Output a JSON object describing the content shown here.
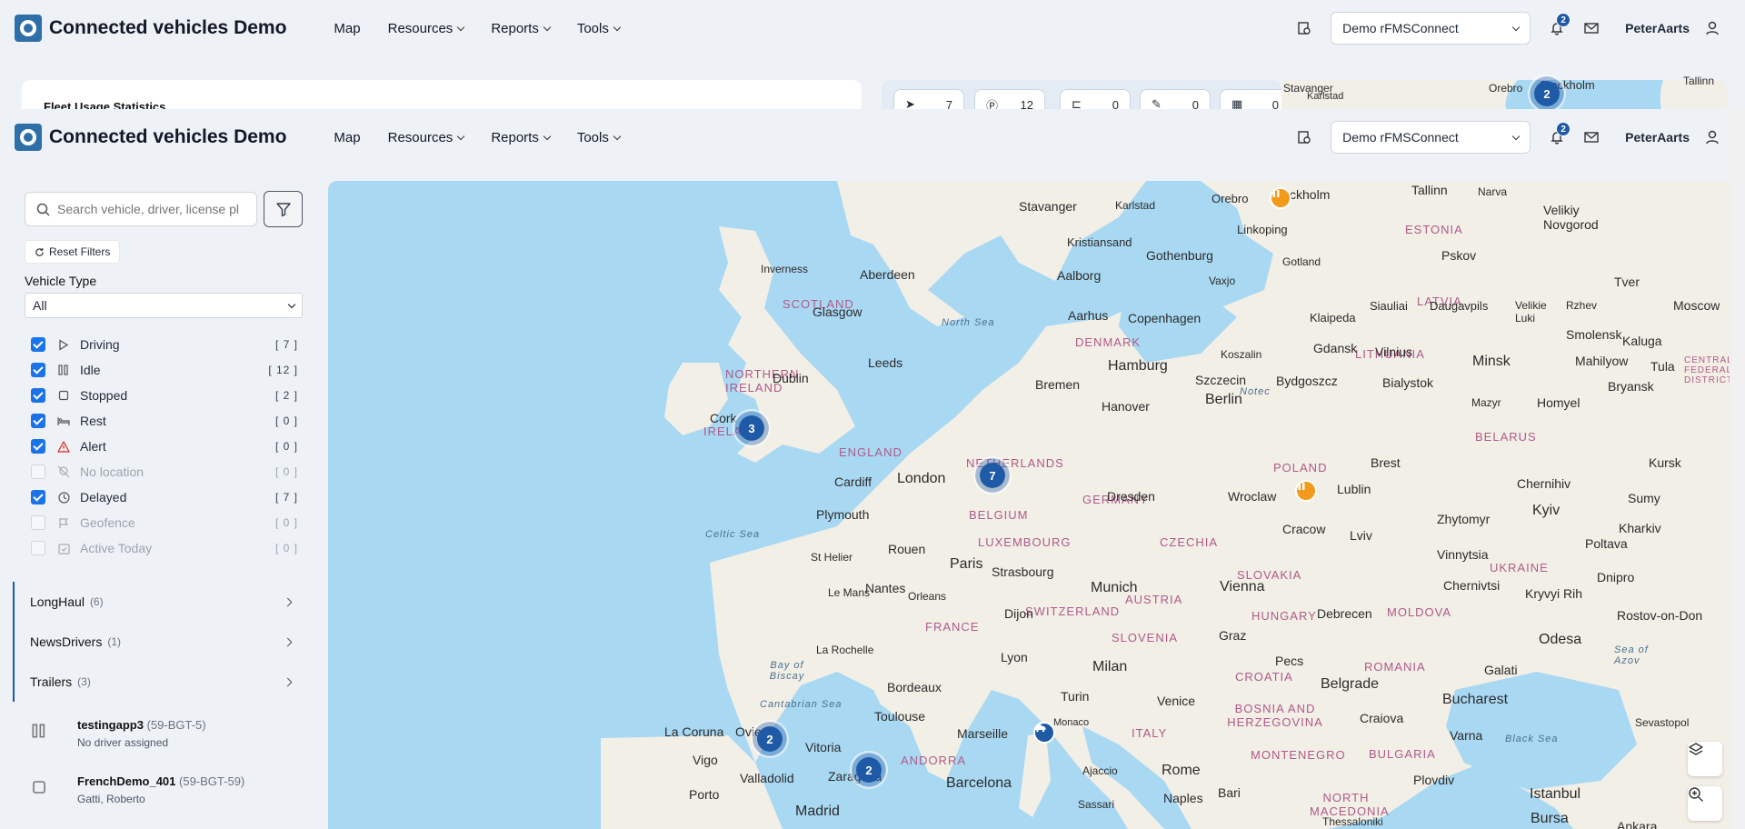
{
  "app": {
    "title": "Connected vehicles Demo",
    "nav": [
      "Map",
      "Resources",
      "Reports",
      "Tools"
    ],
    "account_select": "Demo rFMSConnect",
    "notifications_count": "2",
    "username": "PeterAarts"
  },
  "background": {
    "stats_title": "Fleet Usage Statistics",
    "pills": [
      "7",
      "12",
      "0",
      "0",
      "0"
    ],
    "map_labels": [
      "Stavanger",
      "Karlstad",
      "Orebro",
      "Stockholm",
      "Tallinn"
    ],
    "cluster": "2"
  },
  "sidebar": {
    "search_placeholder": "Search vehicle, driver, license plate",
    "reset_label": "Reset Filters",
    "vehicle_type_label": "Vehicle Type",
    "vehicle_type_value": "All",
    "statuses": [
      {
        "label": "Driving",
        "count": "[ 7 ]",
        "checked": true,
        "icon": "play-icon"
      },
      {
        "label": "Idle",
        "count": "[ 12 ]",
        "checked": true,
        "icon": "idle-icon"
      },
      {
        "label": "Stopped",
        "count": "[ 2 ]",
        "checked": true,
        "icon": "stop-icon"
      },
      {
        "label": "Rest",
        "count": "[ 0 ]",
        "checked": true,
        "icon": "bed-icon"
      },
      {
        "label": "Alert",
        "count": "[ 0 ]",
        "checked": true,
        "icon": "alert-icon"
      },
      {
        "label": "No location",
        "count": "[ 0 ]",
        "checked": false,
        "icon": "no-location-icon"
      },
      {
        "label": "Delayed",
        "count": "[ 7 ]",
        "checked": true,
        "icon": "clock-icon"
      },
      {
        "label": "Geofence",
        "count": "[ 0 ]",
        "checked": false,
        "icon": "geofence-icon"
      },
      {
        "label": "Active Today",
        "count": "[ 0 ]",
        "checked": false,
        "icon": "calendar-check-icon"
      }
    ],
    "groups": [
      {
        "name": "LongHaul",
        "count": "(6)"
      },
      {
        "name": "NewsDrivers",
        "count": "(1)"
      },
      {
        "name": "Trailers",
        "count": "(3)"
      }
    ],
    "vehicles": [
      {
        "name": "testingapp3",
        "plate": "(59-BGT-5)",
        "driver": "No driver assigned"
      },
      {
        "name": "FrenchDemo_401",
        "plate": "(59-BGT-59)",
        "driver": "Gatti, Roberto"
      }
    ]
  },
  "map": {
    "clusters": [
      "3",
      "7",
      "2",
      "2"
    ],
    "colors": {
      "water": "#a9d8f3",
      "land": "#f2efe6",
      "cluster": "#1e5aa6",
      "marker_orange": "#f29a1c"
    },
    "labels": {
      "cities": [
        "Stavanger",
        "Karlstad",
        "Orebro",
        "Stockholm",
        "Tallinn",
        "Narva",
        "Velikiy Novgorod",
        "Kristiansand",
        "Linkoping",
        "Gothenburg",
        "Gotland",
        "Pskov",
        "Inverness",
        "Aberdeen",
        "Aalborg",
        "Vaxjo",
        "Tver",
        "Velikie Luki",
        "Glasgow",
        "Aarhus",
        "Copenhagen",
        "Klaipeda",
        "Siauliai",
        "Daugavpils",
        "Rzhev",
        "Moscow",
        "Smolensk",
        "Kaluga",
        "Leeds",
        "Dublin",
        "Bremen",
        "Hamburg",
        "Koszalin",
        "Gdansk",
        "Vilnius",
        "Minsk",
        "Mahilyow",
        "Tula",
        "Szczecin",
        "Bydgoszcz",
        "Bialystok",
        "Bryansk",
        "Hanover",
        "Berlin",
        "Notec",
        "Mazyr",
        "Homyel",
        "Cork",
        "Cardiff",
        "London",
        "Brest",
        "Kursk",
        "Chernihiv",
        "Dresden",
        "Wroclaw",
        "Lublin",
        "Sumy",
        "Plymouth",
        "Kyiv",
        "Zhytomyr",
        "Kharkiv",
        "Cracow",
        "Lviv",
        "Poltava",
        "St Helier",
        "Rouen",
        "Paris",
        "Strasbourg",
        "Vinnytsia",
        "Munich",
        "Vienna",
        "Chernivtsi",
        "Le Mans",
        "Orleans",
        "Nantes",
        "Dijon",
        "Debrecen",
        "Dnipro",
        "Kryvyi Rih",
        "Rostov-on-Don",
        "Graz",
        "La Rochelle",
        "Odesa",
        "Lyon",
        "Milan",
        "Pecs",
        "Galati",
        "Bordeaux",
        "Turin",
        "Venice",
        "Belgrade",
        "Bucharest",
        "Sevastopol",
        "Toulouse",
        "Craiova",
        "Marseille",
        "Monaco",
        "Varna",
        "La Coruna",
        "Oviedo",
        "Vitoria",
        "Vigo",
        "Zaragoza",
        "Valladolid",
        "Barcelona",
        "Ajaccio",
        "Rome",
        "Plovdiv",
        "Istanbul",
        "Bari",
        "Naples",
        "Sassari",
        "Porto",
        "Madrid",
        "Bursa",
        "Ankara",
        "Thessaloniki"
      ],
      "countries": [
        "ESTONIA",
        "LATVIA",
        "LITHUANIA",
        "SCOTLAND",
        "DENMARK",
        "NORTHERN IRELAND",
        "IRELAND",
        "ENGLAND",
        "NETHERLANDS",
        "BELGIUM",
        "LUXEMBOURG",
        "GERMANY",
        "POLAND",
        "BELARUS",
        "CZECHIA",
        "SLOVAKIA",
        "UKRAINE",
        "FRANCE",
        "SWITZERLAND",
        "AUSTRIA",
        "HUNGARY",
        "MOLDOVA",
        "SLOVENIA",
        "ROMANIA",
        "CROATIA",
        "BOSNIA AND HERZEGOVINA",
        "ITALY",
        "MONTENEGRO",
        "BULGARIA",
        "ANDORRA",
        "NORTH MACEDONIA",
        "CENTRAL FEDERAL DISTRICT"
      ],
      "seas": [
        "North Sea",
        "Celtic Sea",
        "Bay of Biscay",
        "Cantabrian Sea",
        "Black Sea",
        "Sea of Azov"
      ]
    }
  }
}
